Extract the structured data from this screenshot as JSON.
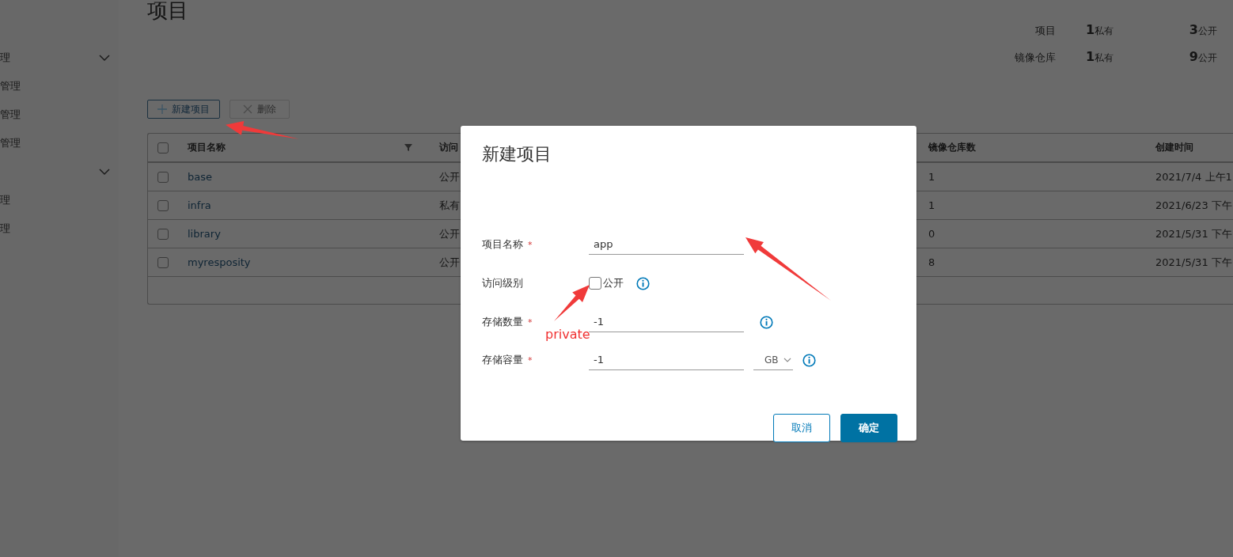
{
  "sidebar": {
    "groups": [
      {
        "label": "理",
        "expanded": true,
        "children": [
          {
            "label": "管理"
          },
          {
            "label": "管理"
          },
          {
            "label": "管理"
          }
        ]
      },
      {
        "expanded": true,
        "children": [
          {
            "label": "理"
          },
          {
            "label": "理"
          }
        ]
      }
    ]
  },
  "page": {
    "title": "项目",
    "summary": [
      {
        "label": "项目",
        "private_count": "1",
        "private_label": "私有",
        "public_count": "3",
        "public_label": "公开"
      },
      {
        "label": "镜像仓库",
        "private_count": "1",
        "private_label": "私有",
        "public_count": "9",
        "public_label": "公开"
      }
    ],
    "toolbar": [
      {
        "kind": "add",
        "label": "新建项目",
        "disabled": false
      },
      {
        "kind": "delete",
        "label": "删除",
        "disabled": true
      }
    ],
    "table": {
      "select_all_checked": false,
      "columns": [
        {
          "label": "项目名称",
          "filter": true
        },
        {
          "label": "访问"
        },
        {
          "label": "镜像仓库数"
        },
        {
          "label": "创建时间"
        }
      ],
      "rows": [
        {
          "checked": false,
          "name": "base",
          "access": "公开",
          "repo_count": "1",
          "created": "2021/7/4 上午1"
        },
        {
          "checked": false,
          "name": "infra",
          "access": "私有",
          "repo_count": "1",
          "created": "2021/6/23 下午"
        },
        {
          "checked": false,
          "name": "library",
          "access": "公开",
          "repo_count": "0",
          "created": "2021/5/31 下午"
        },
        {
          "checked": false,
          "name": "myresposity",
          "access": "公开",
          "repo_count": "8",
          "created": "2021/5/31 下午"
        }
      ]
    }
  },
  "dialog": {
    "title": "新建项目",
    "fields": [
      {
        "kind": "text",
        "label": "项目名称",
        "required_mark": "*",
        "value": "app",
        "info": false
      },
      {
        "kind": "checkbox",
        "label": "访问级别",
        "option": "公开",
        "checked": false,
        "info": true
      },
      {
        "kind": "text",
        "label": "存储数量",
        "required_mark": "*",
        "value": "-1",
        "info": true
      },
      {
        "kind": "text_unit",
        "label": "存储容量",
        "required_mark": "*",
        "value": "-1",
        "unit": "GB",
        "info": true
      }
    ],
    "buttons": [
      {
        "kind": "secondary",
        "label": "取消"
      },
      {
        "kind": "primary",
        "label": "确定"
      }
    ]
  },
  "annotations": [
    {
      "kind": "arrow"
    },
    {
      "kind": "arrow"
    },
    {
      "kind": "arrow"
    },
    {
      "kind": "label",
      "text": "private",
      "color": "#f03030"
    }
  ]
}
